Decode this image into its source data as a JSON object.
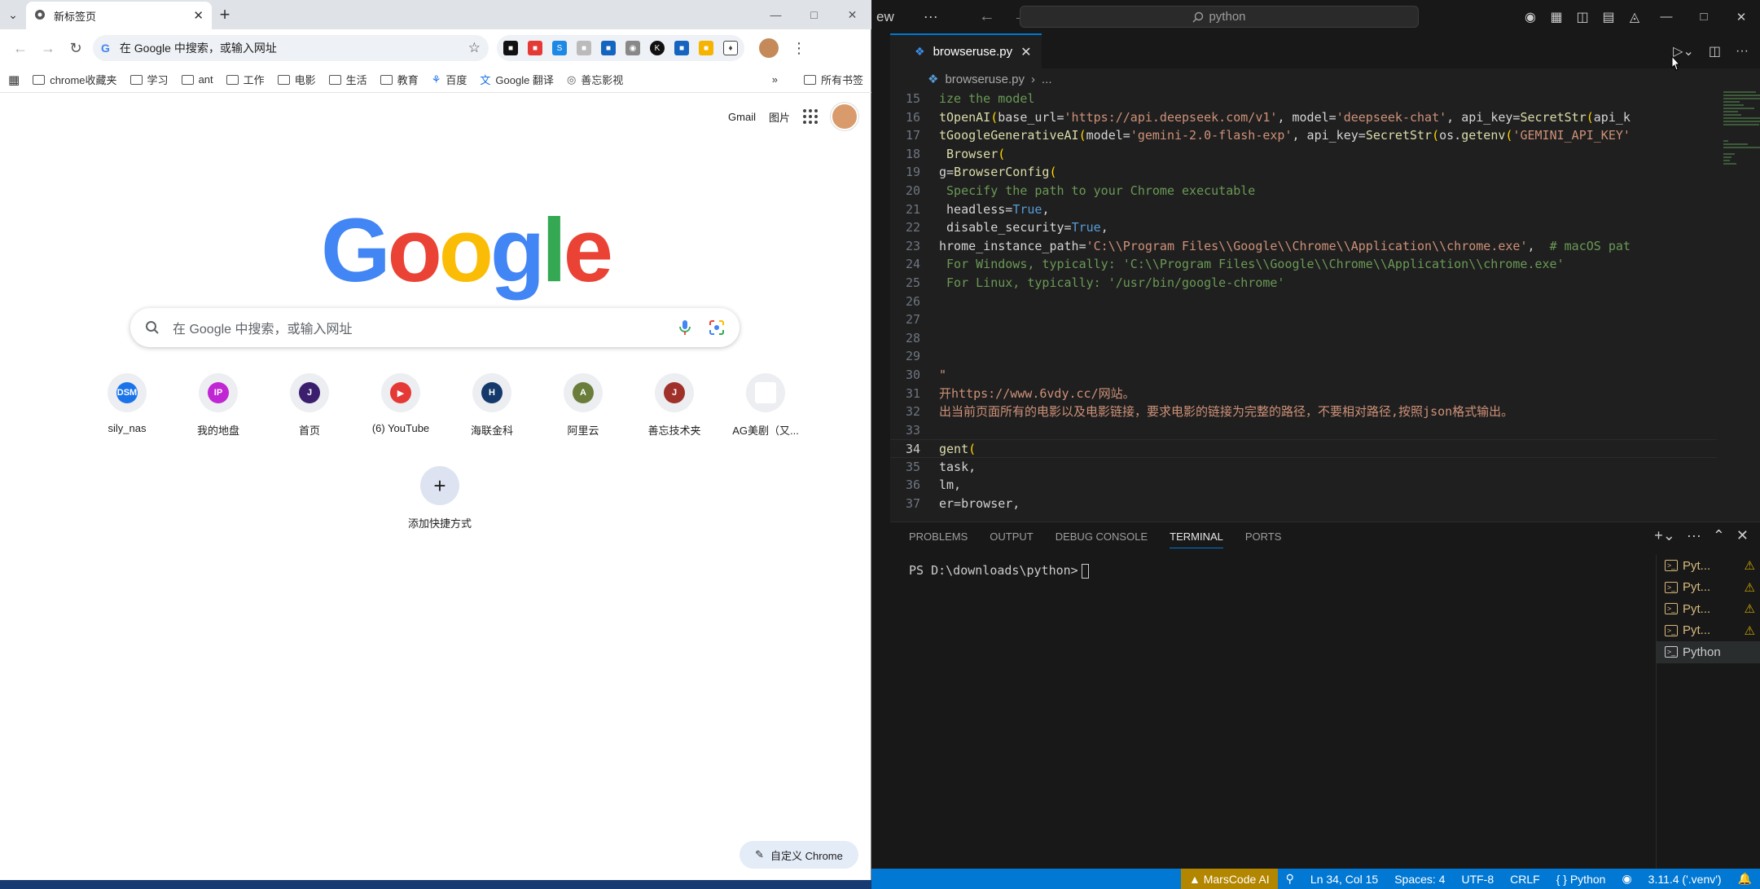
{
  "chrome": {
    "tab_title": "新标签页",
    "omnibox_placeholder": "在 Google 中搜索，或输入网址",
    "bookmarks": [
      "chrome收藏夹",
      "学习",
      "ant",
      "工作",
      "电影",
      "生活",
      "教育",
      "百度",
      "Google 翻译",
      "善忘影视"
    ],
    "all_bookmarks": "所有书签",
    "more_bookmarks": "»",
    "gmail": "Gmail",
    "images": "图片",
    "logo": "Google",
    "search_placeholder": "在 Google 中搜索，或输入网址",
    "shortcuts": [
      {
        "label": "sily_nas",
        "badge": "DSM",
        "color": "#1a73e8"
      },
      {
        "label": "我的地盘",
        "badge": "IP",
        "color": "#c026d3"
      },
      {
        "label": "首页",
        "badge": "J",
        "color": "#3b1f6e"
      },
      {
        "label": "(6) YouTube",
        "badge": "▶",
        "color": "#e53935"
      },
      {
        "label": "海联金科",
        "badge": "H",
        "color": "#143a6b"
      },
      {
        "label": "阿里云",
        "badge": "A",
        "color": "#6b7d3a"
      },
      {
        "label": "善忘技术夹",
        "badge": "J",
        "color": "#a0302a"
      },
      {
        "label": "AG美剧（又...",
        "badge": "",
        "color": "#ffffff"
      }
    ],
    "add_shortcut": "添加快捷方式",
    "customize": "自定义 Chrome",
    "accent": "#1a73e8"
  },
  "vscode": {
    "title_left": "ew",
    "menu_dots": "···",
    "command_center": "python",
    "tab_file": "browseruse.py",
    "breadcrumb_file": "browseruse.py",
    "breadcrumb_more": "...",
    "code_lines": [
      {
        "n": "15",
        "t": "ize the model"
      },
      {
        "n": "16",
        "t": "tOpenAI(base_url='https://api.deepseek.com/v1', model='deepseek-chat', api_key=SecretStr(api_k"
      },
      {
        "n": "17",
        "t": "tGoogleGenerativeAI(model='gemini-2.0-flash-exp', api_key=SecretStr(os.getenv('GEMINI_API_KEY'"
      },
      {
        "n": "18",
        "t": " Browser("
      },
      {
        "n": "19",
        "t": "g=BrowserConfig("
      },
      {
        "n": "20",
        "t": " Specify the path to your Chrome executable"
      },
      {
        "n": "21",
        "t": " headless=True,"
      },
      {
        "n": "22",
        "t": " disable_security=True,"
      },
      {
        "n": "23",
        "t": "hrome_instance_path='C:\\\\Program Files\\\\Google\\\\Chrome\\\\Application\\\\chrome.exe',  # macOS pat"
      },
      {
        "n": "24",
        "t": " For Windows, typically: 'C:\\\\Program Files\\\\Google\\\\Chrome\\\\Application\\\\chrome.exe'"
      },
      {
        "n": "25",
        "t": " For Linux, typically: '/usr/bin/google-chrome'"
      },
      {
        "n": "26",
        "t": ""
      },
      {
        "n": "27",
        "t": ""
      },
      {
        "n": "28",
        "t": ""
      },
      {
        "n": "29",
        "t": ""
      },
      {
        "n": "30",
        "t": "\""
      },
      {
        "n": "31",
        "t": "开https://www.6vdy.cc/网站。"
      },
      {
        "n": "32",
        "t": "出当前页面所有的电影以及电影链接，要求电影的链接为完整的路径，不要相对路径,按照json格式输出。"
      },
      {
        "n": "33",
        "t": ""
      },
      {
        "n": "34",
        "t": "gent("
      },
      {
        "n": "35",
        "t": "task,"
      },
      {
        "n": "36",
        "t": "lm,"
      },
      {
        "n": "37",
        "t": "er=browser,"
      }
    ],
    "panel_tabs": [
      "PROBLEMS",
      "OUTPUT",
      "DEBUG CONSOLE",
      "TERMINAL",
      "PORTS"
    ],
    "active_panel_tab": "TERMINAL",
    "prompt": "PS D:\\downloads\\python>",
    "terminals": [
      "Pyt...",
      "Pyt...",
      "Pyt...",
      "Pyt...",
      "Python"
    ],
    "status": {
      "marscode": "MarsCode AI",
      "position": "Ln 34, Col 15",
      "spaces": "Spaces: 4",
      "encoding": "UTF-8",
      "eol": "CRLF",
      "language": "Python",
      "interpreter": "3.11.4 ('.venv')"
    },
    "accent": "#0078d4"
  }
}
